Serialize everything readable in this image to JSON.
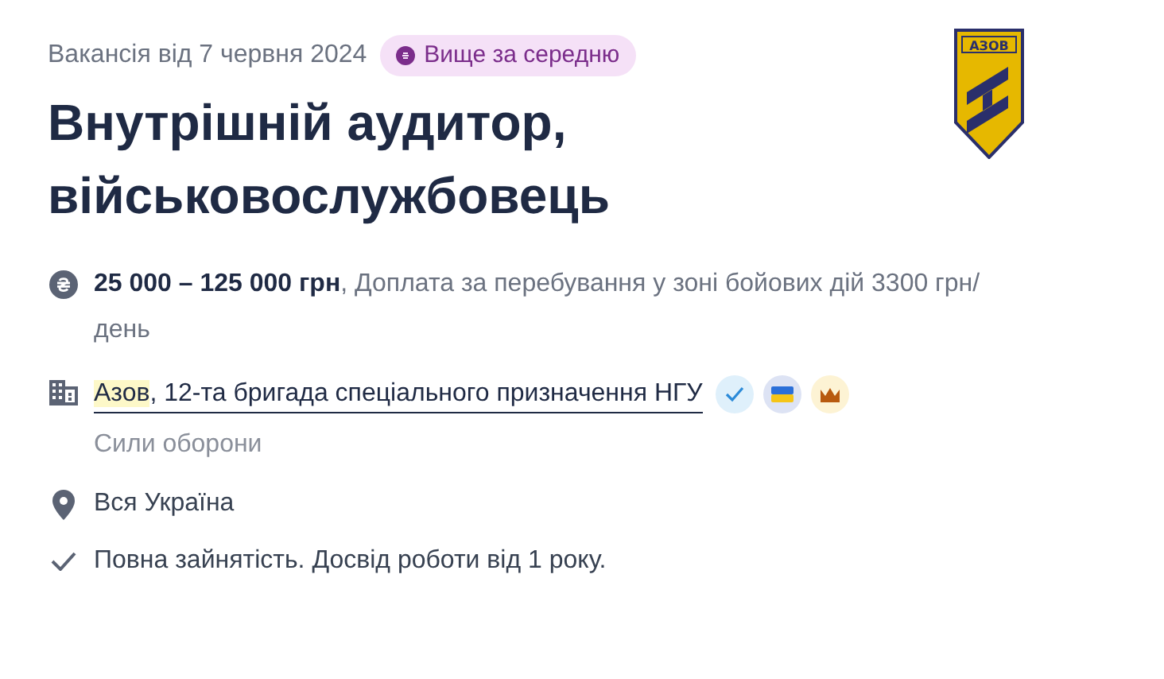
{
  "posted": "Вакансія від 7 червня 2024",
  "badge": {
    "label": "Вище за середню"
  },
  "logo": {
    "text": "АЗОВ"
  },
  "title": "Внутрішній аудитор, військовослужбовець",
  "details": [
    {
      "kind": "salary",
      "text": "**25 000 – 125 000 грн**, Доплата за перебування у зоні бойових дій 3300 грн/ день"
    },
    {
      "kind": "company",
      "highlight": "Азов",
      "name": ", 12-та бригада спеціального призначення НГУ",
      "subtitle": "Сили оборони",
      "marks": [
        {
          "kind": "verified"
        },
        {
          "kind": "flag"
        },
        {
          "kind": "crown"
        }
      ]
    },
    {
      "kind": "location",
      "text": "Вся Україна"
    },
    {
      "kind": "terms",
      "text": "Повна зайнятість. Досвід роботи від 1 року."
    }
  ]
}
